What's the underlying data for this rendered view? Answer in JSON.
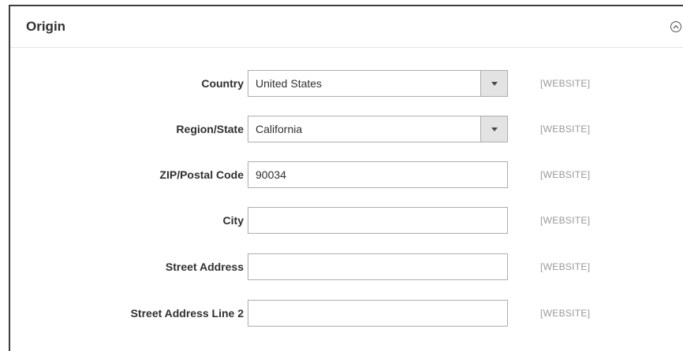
{
  "section": {
    "title": "Origin"
  },
  "fields": [
    {
      "label": "Country",
      "value": "United States",
      "type": "select",
      "scope": "[WEBSITE]"
    },
    {
      "label": "Region/State",
      "value": "California",
      "type": "select",
      "scope": "[WEBSITE]"
    },
    {
      "label": "ZIP/Postal Code",
      "value": "90034",
      "type": "text",
      "scope": "[WEBSITE]"
    },
    {
      "label": "City",
      "value": "",
      "type": "text",
      "scope": "[WEBSITE]"
    },
    {
      "label": "Street Address",
      "value": "",
      "type": "text",
      "scope": "[WEBSITE]"
    },
    {
      "label": "Street Address Line 2",
      "value": "",
      "type": "text",
      "scope": "[WEBSITE]"
    }
  ],
  "icons": {
    "collapse": "chevron-up-circle-icon",
    "select_arrow": "caret-down-icon"
  }
}
